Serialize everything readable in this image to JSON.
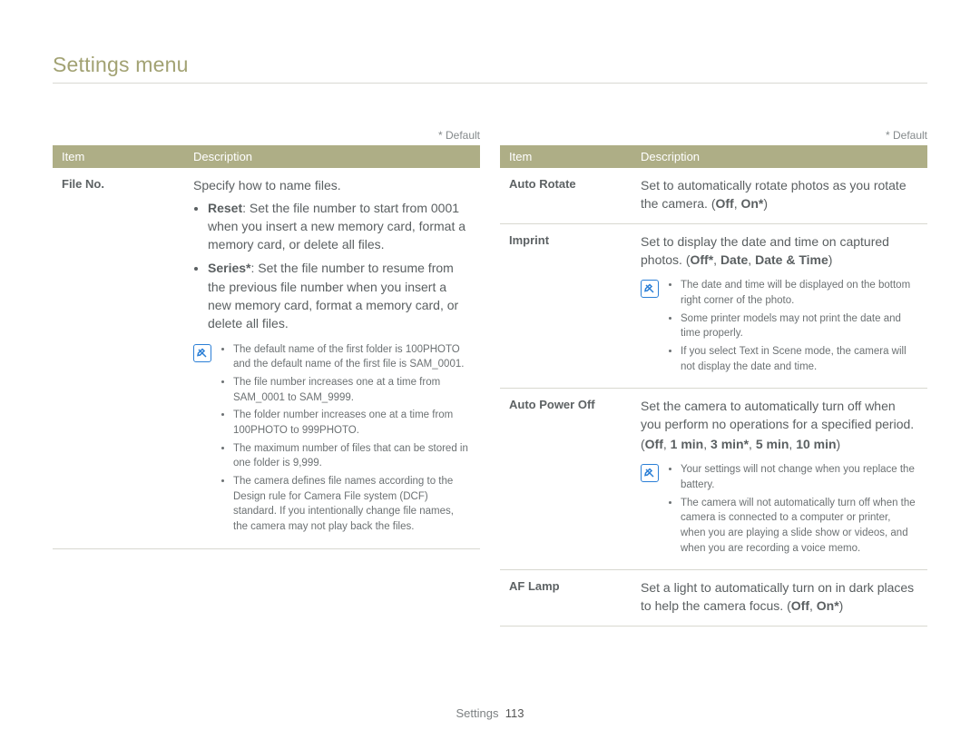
{
  "page_title": "Settings menu",
  "default_label": "* Default",
  "columns": {
    "header_item": "Item",
    "header_desc": "Description"
  },
  "left_rows": {
    "file_no": {
      "item": "File No.",
      "intro": "Specify how to name files.",
      "opt_reset": {
        "label": "Reset",
        "text": ": Set the file number to start from 0001 when you insert a new memory card, format a memory card, or delete all files."
      },
      "opt_series": {
        "label": "Series*",
        "text": ": Set the file number to resume from the previous file number when you insert a new memory card, format a memory card, or delete all files."
      },
      "notes": [
        "The default name of the first folder is 100PHOTO and the default name of the first file is SAM_0001.",
        "The file number increases one at a time from SAM_0001 to SAM_9999.",
        "The folder number increases one at a time from 100PHOTO to 999PHOTO.",
        "The maximum number of files that can be stored in one folder is 9,999.",
        "The camera defines file names according to the Design rule for Camera File system (DCF) standard. If you intentionally change file names, the camera may not play back the files."
      ]
    }
  },
  "right_rows": {
    "auto_rotate": {
      "item": "Auto Rotate",
      "text_a": "Set to automatically rotate photos as you rotate the camera. (",
      "options": [
        "Off",
        "On*"
      ],
      "text_b": ")"
    },
    "imprint": {
      "item": "Imprint",
      "text_a": "Set to display the date and time on captured photos. (",
      "options": [
        "Off*",
        "Date",
        "Date & Time"
      ],
      "text_b": ")",
      "notes": [
        "The date and time will be displayed on the bottom right corner of the photo.",
        "Some printer models may not print the date and time properly."
      ],
      "note_text_prefix": "If you select ",
      "note_text_bold": "Text",
      "note_text_suffix": " in Scene mode, the camera will not display the date and time."
    },
    "auto_power_off": {
      "item": "Auto Power Off",
      "text": "Set the camera to automatically turn off when you perform no operations for a specified period.",
      "options_line": "(Off, 1 min, 3 min*, 5 min, 10 min)",
      "options": [
        "Off",
        "1 min",
        "3 min*",
        "5 min",
        "10 min"
      ],
      "notes": [
        "Your settings will not change when you replace the battery.",
        "The camera will not automatically turn off when the camera is connected to a computer or printer, when you are playing a slide show or videos, and when you are recording a voice memo."
      ]
    },
    "af_lamp": {
      "item": "AF Lamp",
      "text_a": "Set a light to automatically turn on in dark places to help the camera focus. (",
      "options": [
        "Off",
        "On*"
      ],
      "text_b": ")"
    }
  },
  "footer": {
    "section": "Settings",
    "page": "113"
  }
}
